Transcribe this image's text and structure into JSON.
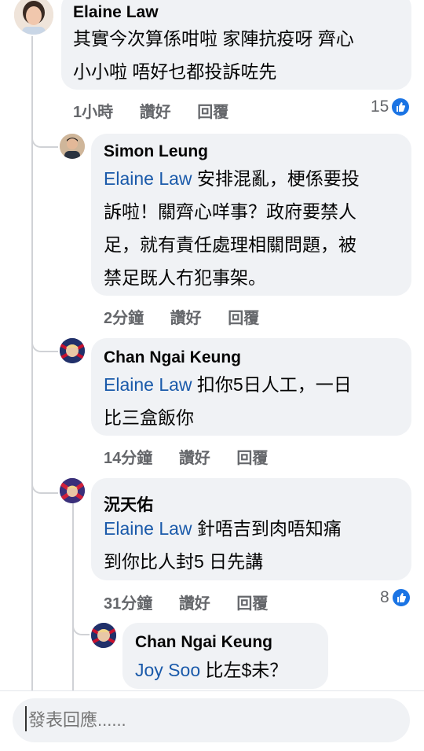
{
  "comments": [
    {
      "author": "Elaine Law",
      "lines": [
        "其實今次算係咁啦 家陣抗疫呀 齊心",
        "小小啦 唔好乜都投訴咗先"
      ],
      "time": "1小時",
      "like": "讚好",
      "reply": "回覆",
      "reaction_count": "15",
      "avatar": "woman-portrait"
    },
    {
      "author": "Simon Leung",
      "mention": "Elaine Law",
      "lines": [
        " 安排混亂，梗係要投",
        "訴啦！關齊心咩事？政府要禁人",
        "足，就有責任處理相關問題，被",
        "禁足既人冇犯事架。"
      ],
      "time": "2分鐘",
      "like": "讚好",
      "reply": "回覆",
      "avatar": "man-portrait"
    },
    {
      "author": "Chan Ngai Keung",
      "mention": "Elaine Law",
      "lines": [
        " 扣你5日人工，一日",
        "比三盒飯你"
      ],
      "time": "14分鐘",
      "like": "讚好",
      "reply": "回覆",
      "avatar": "flag-portrait"
    },
    {
      "author": "況天佑",
      "mention": "Elaine Law",
      "lines": [
        " 針唔吉到肉唔知痛",
        "到你比人封5 日先講"
      ],
      "time": "31分鐘",
      "like": "讚好",
      "reply": "回覆",
      "reaction_count": "8",
      "avatar": "flag-portrait"
    },
    {
      "author": "Chan Ngai Keung",
      "mention": "Joy Soo",
      "lines": [
        " 比左$未？"
      ],
      "avatar": "flag-portrait"
    }
  ],
  "composer": {
    "placeholder": "發表回應......"
  },
  "colors": {
    "mention": "#1a5aaa",
    "like_badge": "#1b74e4",
    "bubble": "#f0f2f5"
  }
}
